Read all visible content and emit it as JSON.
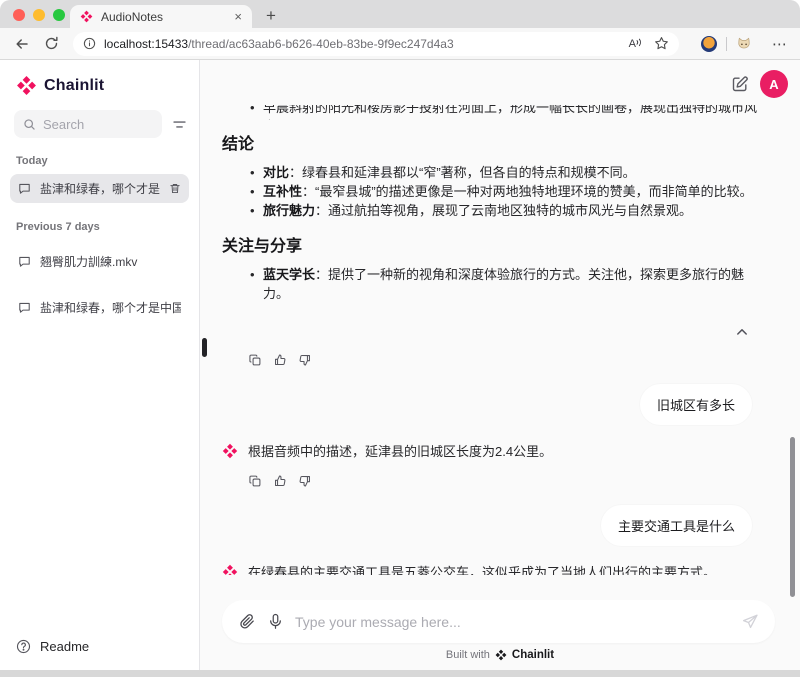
{
  "colors": {
    "accent_pink": "#F0125F",
    "avatar_bg": "#E91E63"
  },
  "icons": {
    "tab_close": "×",
    "new_tab": "+",
    "more": "⋯",
    "read_aloud_letter": "A"
  },
  "browser": {
    "tab_title": "AudioNotes",
    "url_host": "localhost:15433",
    "url_path": "/thread/ac63aab6-b626-40eb-83be-9f9ec247d4a3"
  },
  "sidebar": {
    "brand": "Chainlit",
    "search_placeholder": "Search",
    "today_label": "Today",
    "today_item": "盐津和绿春，哪个才是中...",
    "previous_label": "Previous 7 days",
    "previous_items": [
      "翘臀肌力訓練.mkv",
      "盐津和绿春，哪个才是中国..."
    ],
    "readme": "Readme"
  },
  "header": {
    "avatar": "A"
  },
  "thread": {
    "clipped_bullet": "早晨斜射的阳光和楼房影子投射在河面上，形成一幅长长的画卷，展现出独特的城市风光。",
    "conclusion": {
      "heading": "结论",
      "bullets": [
        {
          "lead": "对比",
          "text": "：绿春县和延津县都以“窄”著称，但各自的特点和规模不同。"
        },
        {
          "lead": "互补性",
          "text": "：“最窄县城”的描述更像是一种对两地独特地理环境的赞美，而非简单的比较。"
        },
        {
          "lead": "旅行魅力",
          "text": "：通过航拍等视角，展现了云南地区独特的城市风光与自然景观。"
        }
      ]
    },
    "share": {
      "heading": "关注与分享",
      "bullets": [
        {
          "lead": "蓝天学长",
          "text": "：提供了一种新的视角和深度体验旅行的方式。关注他，探索更多旅行的魅力。"
        }
      ]
    },
    "messages": [
      {
        "role": "user",
        "text": "旧城区有多长"
      },
      {
        "role": "assistant",
        "text": "根据音频中的描述，延津县的旧城区长度为2.4公里。"
      },
      {
        "role": "user",
        "text": "主要交通工具是什么"
      },
      {
        "role": "assistant",
        "text": "在绿春县的主要交通工具是五菱公交车，这似乎成为了当地人们出行的主要方式。"
      }
    ]
  },
  "composer": {
    "placeholder": "Type your message here..."
  },
  "footer": {
    "built_with": "Built with",
    "brand": "Chainlit"
  }
}
